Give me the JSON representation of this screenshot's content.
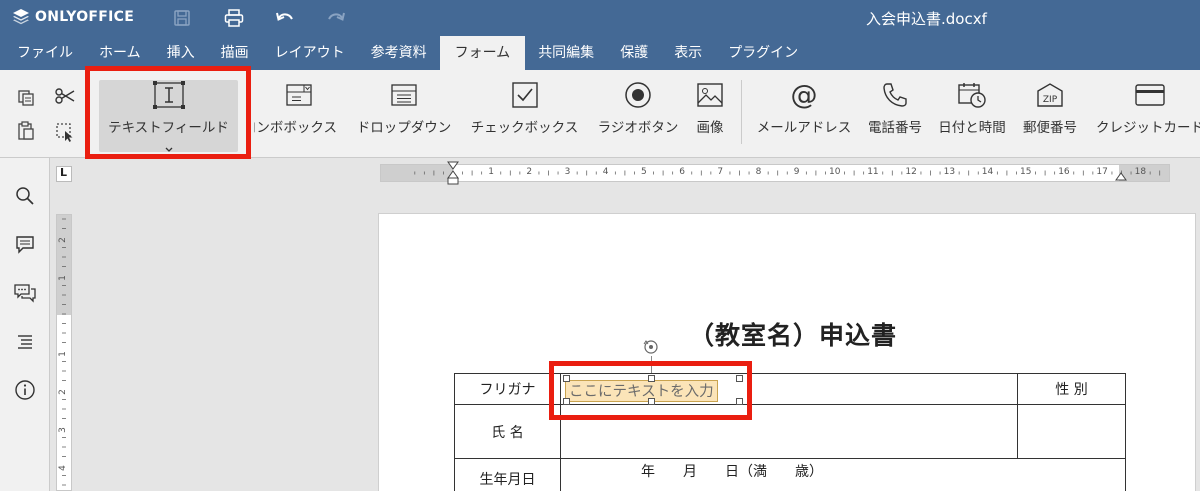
{
  "app": {
    "logo_text": "ONLYOFFICE",
    "doc_title": "入会申込書.docxf"
  },
  "colors": {
    "header": "#446995",
    "highlight": "#ea1e10",
    "field_bg": "#fbe4b8"
  },
  "quick_access": [
    {
      "name": "save-icon",
      "enabled": false
    },
    {
      "name": "print-icon",
      "enabled": true
    },
    {
      "name": "undo-icon",
      "enabled": true
    },
    {
      "name": "redo-icon",
      "enabled": false
    }
  ],
  "tabs": [
    {
      "label": "ファイル"
    },
    {
      "label": "ホーム"
    },
    {
      "label": "挿入"
    },
    {
      "label": "描画"
    },
    {
      "label": "レイアウト"
    },
    {
      "label": "参考資料"
    },
    {
      "label": "フォーム",
      "active": true
    },
    {
      "label": "共同編集"
    },
    {
      "label": "保護"
    },
    {
      "label": "表示"
    },
    {
      "label": "プラグイン"
    }
  ],
  "toolbar": {
    "text_field": "テキストフィールド",
    "combo_box": "コンボボックス",
    "dropdown": "ドロップダウン",
    "checkbox": "チェックボックス",
    "radio": "ラジオボタン",
    "image": "画像",
    "email": "メールアドレス",
    "phone": "電話番号",
    "datetime": "日付と時間",
    "zip": "郵便番号",
    "zip_icon_text": "ZIP",
    "credit_card": "クレジットカード"
  },
  "ruler": {
    "h_numbers": [
      "1",
      "2",
      "3",
      "4",
      "5",
      "6",
      "7",
      "8",
      "9",
      "10",
      "11",
      "12",
      "13",
      "14",
      "15",
      "16",
      "17",
      "18"
    ],
    "v_numbers": [
      "2",
      "1",
      "1",
      "2",
      "3",
      "4"
    ],
    "corner_mark": "L"
  },
  "document": {
    "heading": "（教室名）申込書",
    "rows": {
      "furigana_label": "フリガナ",
      "gender_label": "性 別",
      "name_label": "氏 名",
      "birth_label": "生年月日",
      "birth_value": "年　　月　　日（満　　歳）"
    },
    "text_field_placeholder": "ここにテキストを入力"
  }
}
